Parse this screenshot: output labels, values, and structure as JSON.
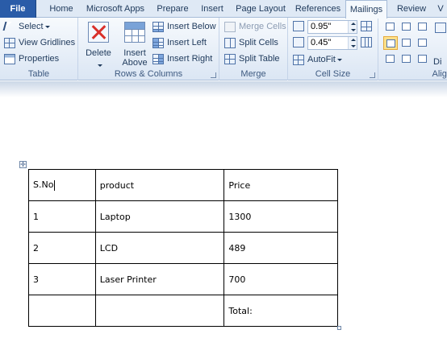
{
  "tabs": [
    {
      "label": "File",
      "active": false,
      "is_file": true
    },
    {
      "label": "Home",
      "active": false
    },
    {
      "label": "Microsoft Apps",
      "active": false
    },
    {
      "label": "Prepare",
      "active": false
    },
    {
      "label": "Insert",
      "active": false
    },
    {
      "label": "Page Layout",
      "active": false
    },
    {
      "label": "References",
      "active": false
    },
    {
      "label": "Mailings",
      "active": true
    },
    {
      "label": "Review",
      "active": false
    },
    {
      "label": "V",
      "active": false
    }
  ],
  "ribbon": {
    "table_group": {
      "label": "Table",
      "select": "Select",
      "view_gridlines": "View Gridlines",
      "properties": "Properties"
    },
    "rows_columns_group": {
      "label": "Rows & Columns",
      "delete": "Delete",
      "insert_above": "Insert\nAbove",
      "insert_above_line1": "Insert",
      "insert_above_line2": "Above",
      "insert_below": "Insert Below",
      "insert_left": "Insert Left",
      "insert_right": "Insert Right"
    },
    "merge_group": {
      "label": "Merge",
      "merge_cells": "Merge Cells",
      "split_cells": "Split Cells",
      "split_table": "Split Table"
    },
    "cell_size_group": {
      "label": "Cell Size",
      "height": "0.95\"",
      "width": "0.45\"",
      "autofit": "AutoFit"
    },
    "alignment_group": {
      "label": "Align",
      "directions": "Di"
    }
  },
  "document": {
    "table": {
      "rows": [
        [
          "S.No",
          "product",
          "Price"
        ],
        [
          "1",
          "Laptop",
          "1300"
        ],
        [
          "2",
          "LCD",
          "489"
        ],
        [
          "3",
          "Laser Printer",
          "700"
        ],
        [
          "",
          "",
          "Total:"
        ]
      ]
    }
  },
  "colors": {
    "file_tab": "#2a5ca8",
    "ribbon_text": "#1e395b",
    "delete_red": "#d9302a",
    "selected_align": "#ffe08a"
  }
}
